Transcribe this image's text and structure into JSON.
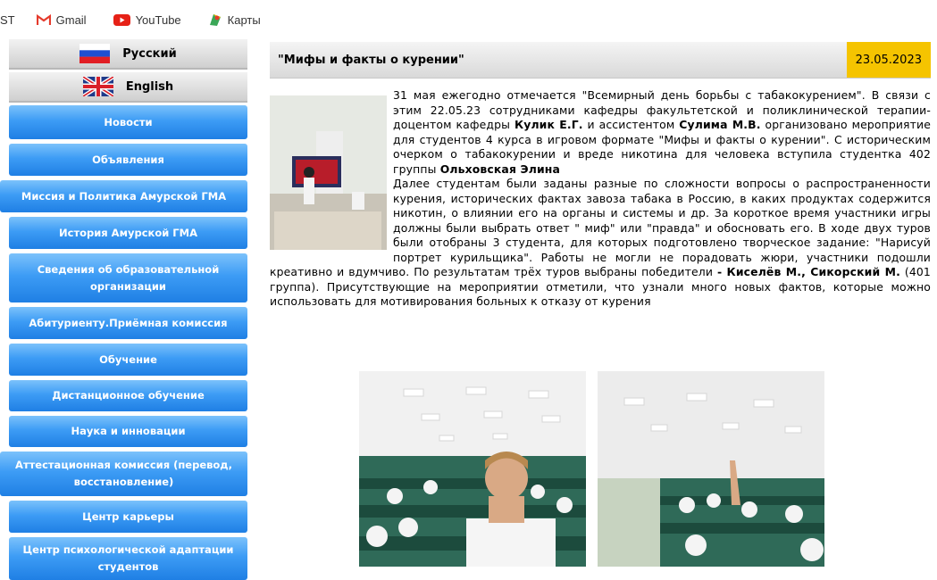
{
  "bookmarks": [
    {
      "label": "ST",
      "icon": "bookmark-partial-icon"
    },
    {
      "label": "Gmail",
      "icon": "gmail-icon"
    },
    {
      "label": "YouTube",
      "icon": "youtube-icon"
    },
    {
      "label": "Карты",
      "icon": "maps-icon"
    }
  ],
  "languages": [
    {
      "label": "Русский",
      "icon": "russia-flag-icon"
    },
    {
      "label": "English",
      "icon": "uk-flag-icon"
    }
  ],
  "nav": [
    "Новости",
    "Объявления",
    "Миссия и Политика Амурской ГМА",
    "История Амурской ГМА",
    "Сведения об образовательной организации",
    "Абитуриенту.Приёмная комиссия",
    "Обучение",
    "Дистанционное обучение",
    "Наука и инновации",
    "Аттестационная комиссия (перевод, восстановление)",
    "Центр карьеры",
    "Центр психологической адаптации студентов"
  ],
  "article": {
    "title": "\"Мифы и факты о курении\"",
    "date": "23.05.2023",
    "p1_a": "31 мая ежегодно отмечается \"Всемирный день борьбы с табакокурением\". В связи с этим 22.05.23 сотрудниками кафедры факультетской и поликлинической терапии- доцентом кафедры ",
    "p1_b": "Кулик Е.Г.",
    "p1_c": " и ассистентом ",
    "p1_d": "Сулима М.В.",
    "p1_e": " организовано мероприятие для студентов 4 курса в игровом формате \"Мифы и факты о курении\". С историческим очерком о табакокурении и вреде никотина для человека вступила студентка 402 группы ",
    "p1_f": "Ольховская Элина",
    "p2_a": "Далее студентам были заданы разные по сложности вопросы о распространенности курения, исторических фактах завоза табака в Россию, в каких продуктах содержится никотин, о влиянии его на органы и системы и др. За короткое время участники игры должны были выбрать ответ \" миф\" или \"правда\" и обосновать его. В ходе двух туров были отобраны 3 студента, для которых подготовлено творческое задание: \"Нарисуй портрет курильщика\". Работы не могли не порадовать жюри, участники подошли креативно и вдумчиво. По результатам трёх туров выбраны победители ",
    "p2_b": "- Киселёв М., Сикорский М.",
    "p2_c": " (401 группа). Присутствующие на мероприятии отметили, что узнали много новых фактов, которые можно использовать для мотивирования больных к отказу от курения"
  }
}
